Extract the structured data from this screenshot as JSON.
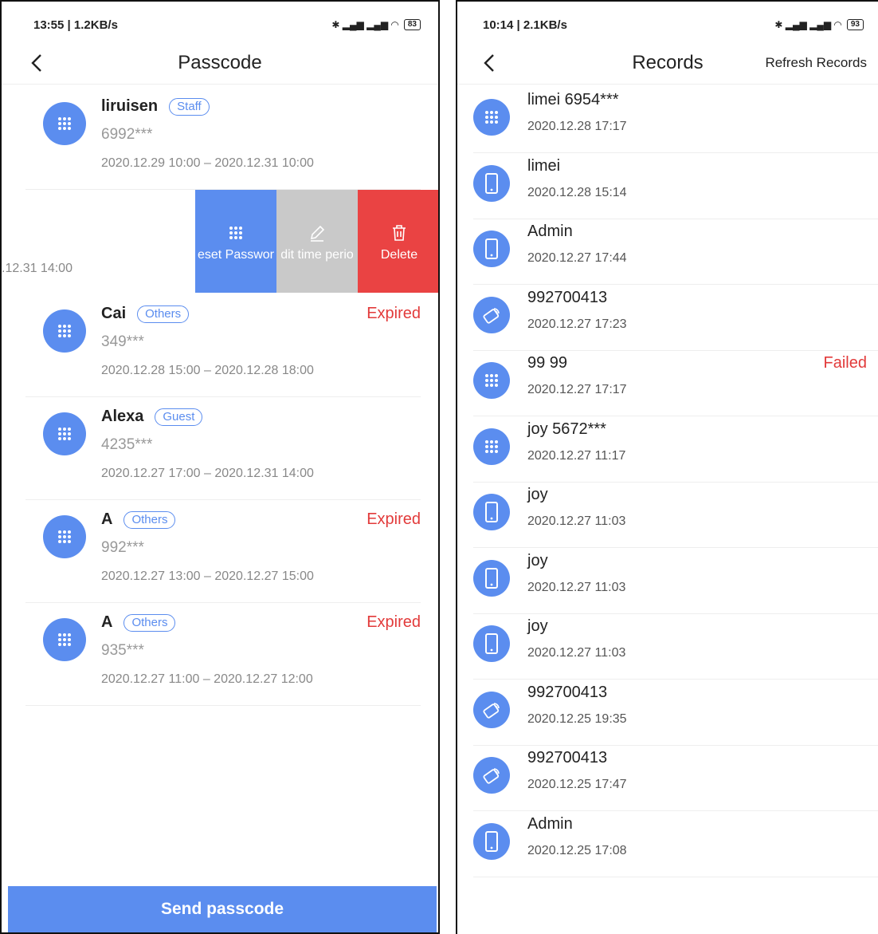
{
  "colors": {
    "accent": "#5b8def",
    "danger": "#ea4343",
    "expired": "#e23a3a",
    "edit": "#c9c9c9"
  },
  "left": {
    "status_bar": {
      "time": "13:55 | 1.2KB/s",
      "icons": "⚠ ⏰ ···",
      "battery": "83"
    },
    "title": "Passcode",
    "rows": [
      {
        "name": "liruisen",
        "tag": "Staff",
        "code": "6992***",
        "period": "2020.12.29 10:00 – 2020.12.31 10:00",
        "status": ""
      },
      {
        "name": "Cai",
        "tag": "Others",
        "code": "349***",
        "period": "2020.12.28 15:00 – 2020.12.28 18:00",
        "status": "Expired"
      },
      {
        "name": "Alexa",
        "tag": "Guest",
        "code": "4235***",
        "period": "2020.12.27 17:00 – 2020.12.31 14:00",
        "status": ""
      },
      {
        "name": "A",
        "tag": "Others",
        "code": "992***",
        "period": "2020.12.27 13:00 – 2020.12.27 15:00",
        "status": "Expired"
      },
      {
        "name": "A",
        "tag": "Others",
        "code": "935***",
        "period": "2020.12.27 11:00 – 2020.12.27 12:00",
        "status": "Expired"
      }
    ],
    "swiped_row": {
      "period": ".12.31 14:00",
      "actions": {
        "reset": "eset Passwor",
        "edit": "dit time perio",
        "delete": "Delete"
      }
    },
    "send_button": "Send passcode"
  },
  "right": {
    "status_bar": {
      "time": "10:14 | 2.1KB/s",
      "icons": "⚠ ⏰ ··",
      "battery": "93"
    },
    "title": "Records",
    "refresh_label": "Refresh Records",
    "records": [
      {
        "name": "limei 6954***",
        "time": "2020.12.28 17:17",
        "icon": "keypad-icon",
        "status": ""
      },
      {
        "name": "limei",
        "time": "2020.12.28 15:14",
        "icon": "phone-icon",
        "status": ""
      },
      {
        "name": "Admin",
        "time": "2020.12.27 17:44",
        "icon": "phone-icon",
        "status": ""
      },
      {
        "name": "992700413",
        "time": "2020.12.27 17:23",
        "icon": "card-icon",
        "status": ""
      },
      {
        "name": "99 99",
        "time": "2020.12.27 17:17",
        "icon": "keypad-icon",
        "status": "Failed"
      },
      {
        "name": "joy 5672***",
        "time": "2020.12.27 11:17",
        "icon": "keypad-icon",
        "status": ""
      },
      {
        "name": "joy",
        "time": "2020.12.27 11:03",
        "icon": "phone-icon",
        "status": ""
      },
      {
        "name": "joy",
        "time": "2020.12.27 11:03",
        "icon": "phone-icon",
        "status": ""
      },
      {
        "name": "joy",
        "time": "2020.12.27 11:03",
        "icon": "phone-icon",
        "status": ""
      },
      {
        "name": "992700413",
        "time": "2020.12.25 19:35",
        "icon": "card-icon",
        "status": ""
      },
      {
        "name": "992700413",
        "time": "2020.12.25 17:47",
        "icon": "card-icon",
        "status": ""
      },
      {
        "name": "Admin",
        "time": "2020.12.25 17:08",
        "icon": "phone-icon",
        "status": ""
      }
    ]
  }
}
